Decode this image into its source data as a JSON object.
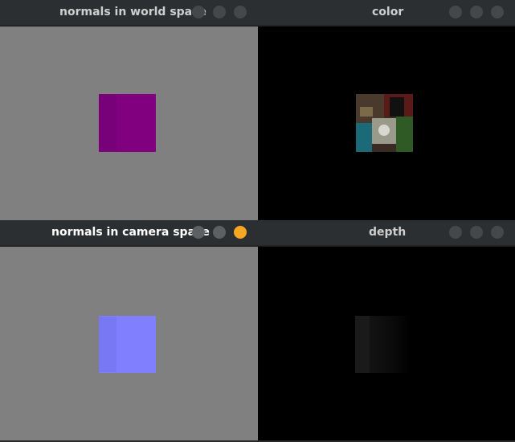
{
  "windows": [
    {
      "id": "normals-world",
      "title": "normals in world space",
      "active": false,
      "content_description": "magenta-square"
    },
    {
      "id": "color",
      "title": "color",
      "active": false,
      "content_description": "photo-texture-square"
    },
    {
      "id": "normals-camera",
      "title": "normals in camera space",
      "active": true,
      "content_description": "blue-square"
    },
    {
      "id": "depth",
      "title": "depth",
      "active": false,
      "content_description": "dark-gradient-square"
    }
  ],
  "colors": {
    "titlebar": "#2c2f31",
    "active_close": "#f5a623",
    "gray_background": "#808080",
    "magenta": "#800080",
    "blue": "#8080ff"
  },
  "icons": {
    "close": "close-icon",
    "maximize": "maximize-icon",
    "minimize": "minimize-icon"
  }
}
